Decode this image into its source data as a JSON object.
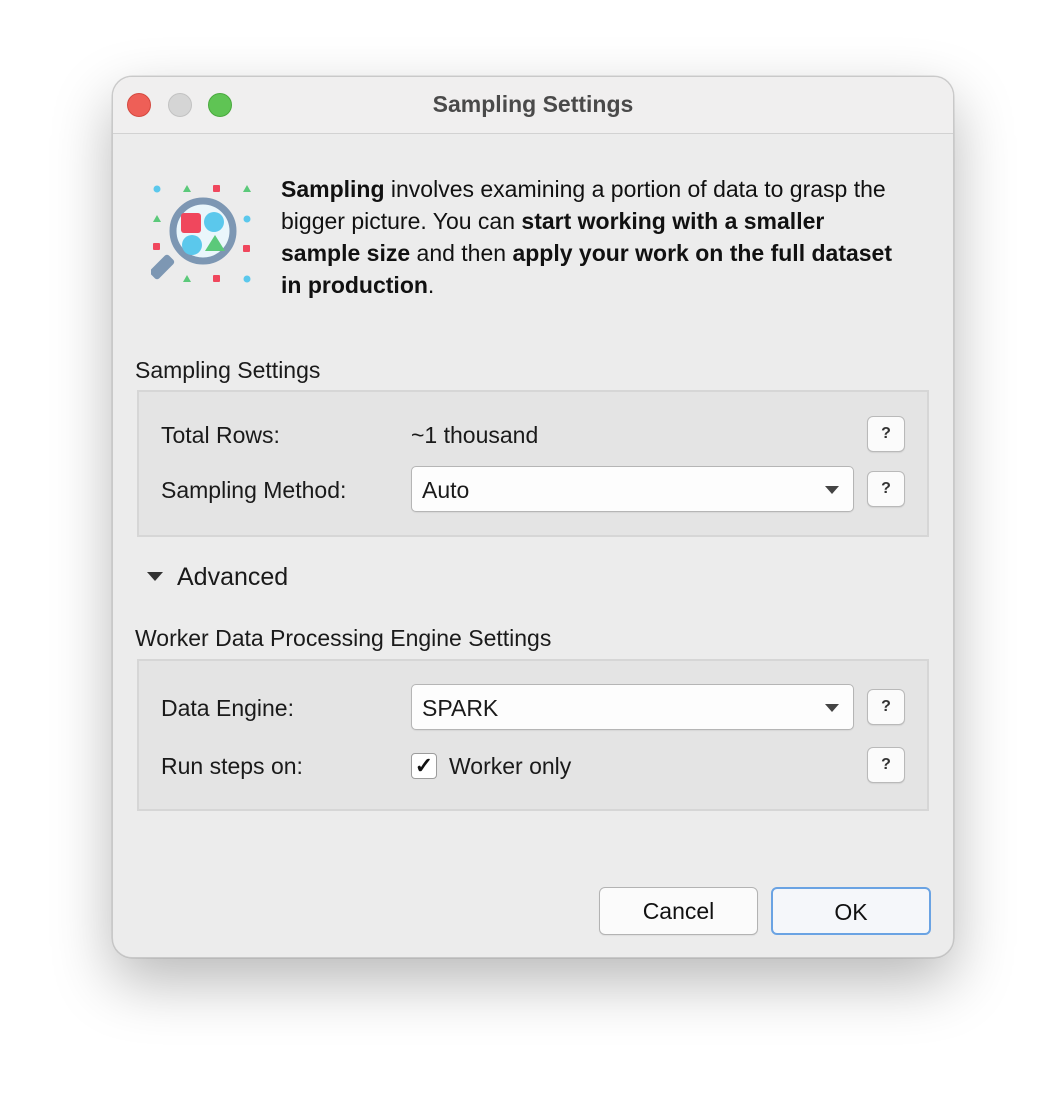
{
  "window": {
    "title": "Sampling Settings",
    "traffic_lights": [
      "close",
      "minimize",
      "zoom"
    ]
  },
  "intro": {
    "icon": "sampling-magnifier-icon",
    "parts": [
      {
        "text": "Sampling",
        "bold": true
      },
      {
        "text": " involves examining a portion of data to grasp the bigger picture. You can ",
        "bold": false
      },
      {
        "text": "start working with a smaller sample size",
        "bold": true
      },
      {
        "text": " and then ",
        "bold": false
      },
      {
        "text": "apply your work on the full dataset in production",
        "bold": true
      },
      {
        "text": ".",
        "bold": false
      }
    ]
  },
  "sampling": {
    "section_label": "Sampling Settings",
    "total_rows_label": "Total Rows:",
    "total_rows_value": "~1 thousand",
    "method_label": "Sampling Method:",
    "method_value": "Auto",
    "help": "?"
  },
  "advanced": {
    "label": "Advanced",
    "expanded": true
  },
  "engine": {
    "section_label": "Worker Data Processing Engine Settings",
    "data_engine_label": "Data Engine:",
    "data_engine_value": "SPARK",
    "run_steps_label": "Run steps on:",
    "worker_only_label": "Worker only",
    "worker_only_checked": true,
    "check_mark": "✓",
    "help": "?"
  },
  "buttons": {
    "cancel": "Cancel",
    "ok": "OK"
  },
  "colors": {
    "accent_blue": "#6aa3e3",
    "icon_red": "#f0475d",
    "icon_cyan": "#5bc8ec",
    "icon_green": "#5bc97a",
    "icon_slate": "#7d97b3"
  }
}
